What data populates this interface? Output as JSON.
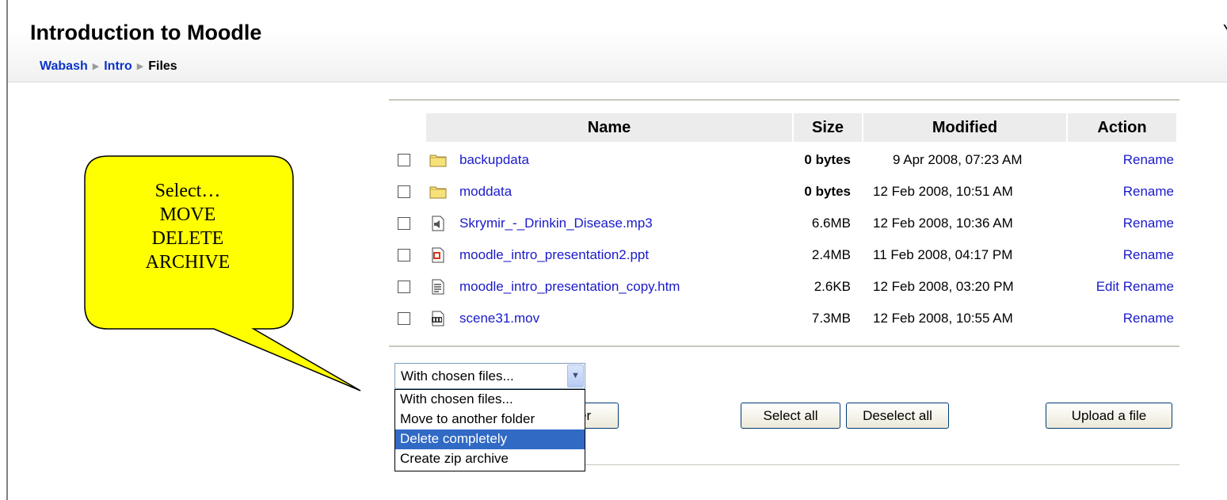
{
  "header": {
    "title": "Introduction to Moodle",
    "corner_char": "Y",
    "breadcrumb": [
      "Wabash",
      "Intro",
      "Files"
    ]
  },
  "table": {
    "columns": [
      "Name",
      "Size",
      "Modified",
      "Action"
    ],
    "rows": [
      {
        "name": "backupdata",
        "icon": "folder-icon",
        "size": "0 bytes",
        "modified": "9 Apr 2008, 07:23 AM",
        "actions": [
          "Rename"
        ]
      },
      {
        "name": "moddata",
        "icon": "folder-icon",
        "size": "0 bytes",
        "modified": "12 Feb 2008, 10:51 AM",
        "actions": [
          "Rename"
        ]
      },
      {
        "name": "Skrymir_-_Drinkin_Disease.mp3",
        "icon": "audio-file-icon",
        "size": "6.6MB",
        "modified": "12 Feb 2008, 10:36 AM",
        "actions": [
          "Rename"
        ]
      },
      {
        "name": "moodle_intro_presentation2.ppt",
        "icon": "powerpoint-file-icon",
        "size": "2.4MB",
        "modified": "11 Feb 2008, 04:17 PM",
        "actions": [
          "Rename"
        ]
      },
      {
        "name": "moodle_intro_presentation_copy.htm",
        "icon": "html-file-icon",
        "size": "2.6KB",
        "modified": "12 Feb 2008, 03:20 PM",
        "actions": [
          "Edit",
          "Rename"
        ]
      },
      {
        "name": "scene31.mov",
        "icon": "video-file-icon",
        "size": "7.3MB",
        "modified": "12 Feb 2008, 10:55 AM",
        "actions": [
          "Rename"
        ]
      }
    ]
  },
  "chosen_files": {
    "selected_value": "With chosen files...",
    "options": [
      "With chosen files...",
      "Move to another folder",
      "Delete completely",
      "Create zip archive"
    ],
    "highlighted_option": "Delete completely"
  },
  "buttons": {
    "partial_hidden_label": "er",
    "select_all": "Select all",
    "deselect_all": "Deselect all",
    "upload": "Upload a file"
  },
  "callout": {
    "lines": [
      "Select…",
      "MOVE",
      "DELETE",
      "ARCHIVE"
    ],
    "fill_color": "#ffff00"
  },
  "colors": {
    "link": "#1a1aca",
    "breadcrumb_link": "#0b33c8",
    "highlight": "#316ac5"
  }
}
